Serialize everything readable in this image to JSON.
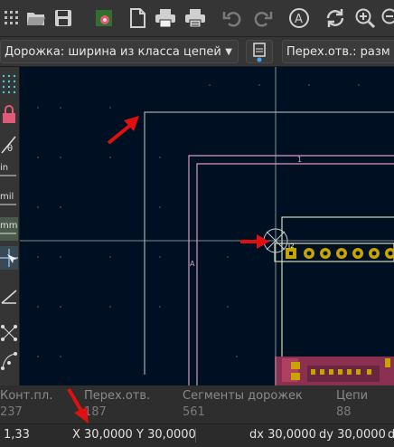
{
  "toolbar": {
    "icons": [
      "zoom-grid-icon",
      "folder-open-icon",
      "save-icon",
      "library-icon",
      "page-icon",
      "print-icon",
      "plot-icon",
      "undo-icon",
      "redo-icon",
      "search-icon",
      "refresh-icon",
      "zoom-in-icon",
      "zoom-out-icon"
    ]
  },
  "options": {
    "track_width": "Дорожка: ширина из класса цепей",
    "via_size": "Перех.отв.: разм"
  },
  "board": {
    "label_1": "1",
    "label_A": "A",
    "connector_ref": "J2"
  },
  "messages": {
    "pads_label": "Конт.пл.",
    "pads_value": "237",
    "vias_label": "Перех.отв.",
    "vias_value": "187",
    "segments_label": "Сегменты дорожек",
    "segments_value": "561",
    "nets_label": "Цепи",
    "nets_value": "88"
  },
  "status": {
    "zoom": "1,33",
    "x": "X 30,0000",
    "y": "Y 30,0000",
    "dx": "dx 30,0000",
    "dy": "dy 30,0000",
    "dist": "dist"
  },
  "colors": {
    "canvas_bg": "#001023",
    "edge_cuts": "#c8c8c8",
    "courtyard": "#d99ac0",
    "copper_pad": "#c8a400",
    "arrow": "#e01010"
  }
}
